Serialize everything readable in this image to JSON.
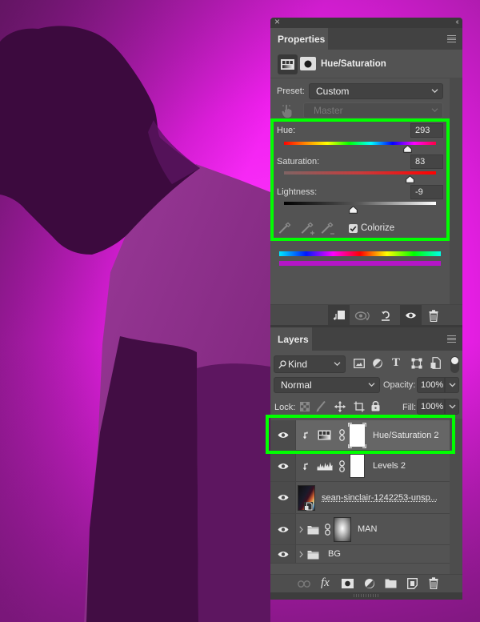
{
  "highlight": {
    "color": "#00ff00"
  },
  "properties": {
    "close_glyph": "×",
    "collapse_glyph": "‹‹",
    "tab_label": "Properties",
    "adjustment_title": "Hue/Saturation",
    "preset": {
      "label": "Preset:",
      "value": "Custom"
    },
    "channel": {
      "value": "Master"
    },
    "hue": {
      "label": "Hue:",
      "value": "293",
      "min": 0,
      "max": 360
    },
    "saturation": {
      "label": "Saturation:",
      "value": "83",
      "min": 0,
      "max": 100
    },
    "lightness": {
      "label": "Lightness:",
      "value": "-9",
      "min": -100,
      "max": 100
    },
    "colorize": {
      "label": "Colorize",
      "checked": true
    },
    "toolbar_icons": [
      "clip-to-layer-icon",
      "view-previous-state-icon",
      "reset-icon",
      "toggle-visibility-icon",
      "delete-icon"
    ]
  },
  "layers": {
    "tab_label": "Layers",
    "filter": {
      "value": "Kind"
    },
    "blend_mode": {
      "value": "Normal"
    },
    "opacity": {
      "label": "Opacity:",
      "value": "100%"
    },
    "lock": {
      "label": "Lock:"
    },
    "fill": {
      "label": "Fill:",
      "value": "100%"
    },
    "items": [
      {
        "name": "Hue/Saturation 2",
        "kind": "hue-saturation-adjustment",
        "clipped": true,
        "selected": true,
        "visible": true
      },
      {
        "name": "Levels 2",
        "kind": "levels-adjustment",
        "clipped": true,
        "selected": false,
        "visible": true
      },
      {
        "name": "sean-sinclair-1242253-unsp...",
        "kind": "smart-object",
        "selected": false,
        "visible": true
      },
      {
        "name": "MAN",
        "kind": "group-with-mask",
        "selected": false,
        "visible": true
      },
      {
        "name": "BG",
        "kind": "group",
        "selected": false,
        "visible": true
      }
    ],
    "bottom_icons": [
      "link-layers-icon",
      "fx-icon",
      "add-mask-icon",
      "new-adjustment-icon",
      "new-group-icon",
      "new-layer-icon",
      "delete-layer-icon"
    ]
  }
}
